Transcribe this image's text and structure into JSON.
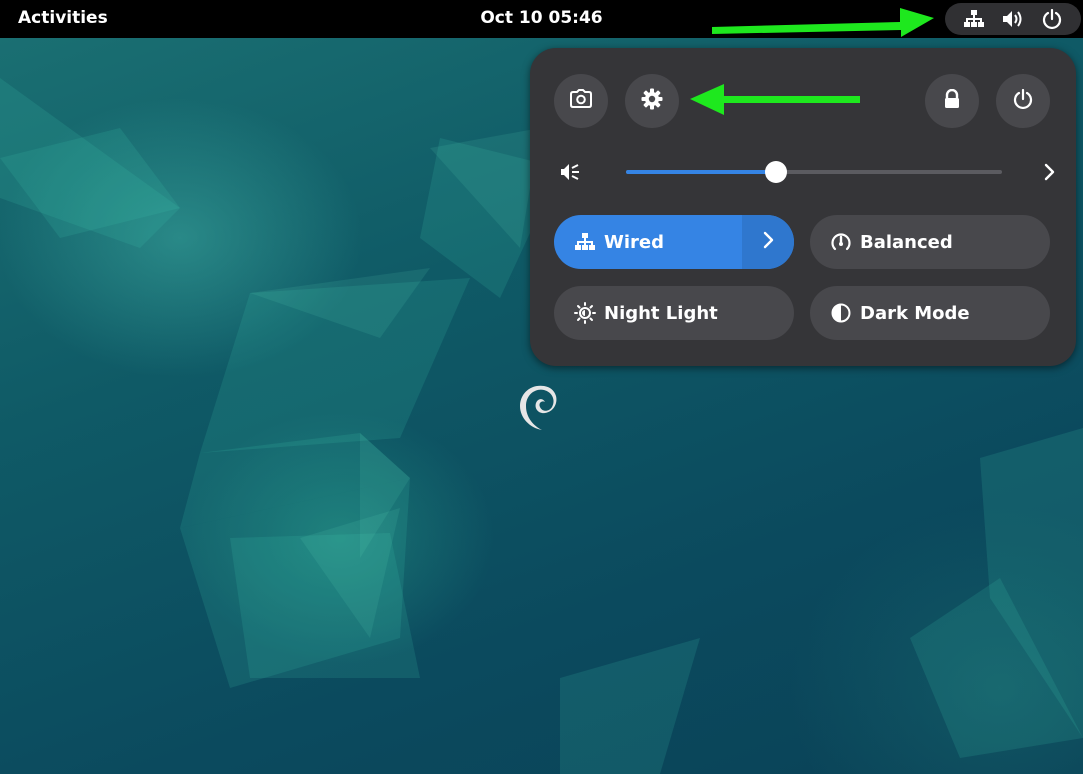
{
  "topbar": {
    "activities_label": "Activities",
    "clock": "Oct 10  05:46",
    "status_icons": [
      "network-wired-icon",
      "volume-icon",
      "power-icon"
    ]
  },
  "quick_settings": {
    "buttons_left": [
      "screenshot-icon",
      "settings-gear-icon"
    ],
    "buttons_right": [
      "lock-icon",
      "power-icon"
    ],
    "volume": {
      "icon": "volume-muted-icon",
      "level": 0.4
    },
    "toggles": [
      {
        "label": "Wired",
        "icon": "network-wired-icon",
        "active": true,
        "has_menu": true
      },
      {
        "label": "Balanced",
        "icon": "power-profile-icon",
        "active": false
      },
      {
        "label": "Night Light",
        "icon": "night-light-icon",
        "active": false
      },
      {
        "label": "Dark Mode",
        "icon": "dark-mode-icon",
        "active": false
      }
    ]
  },
  "colors": {
    "accent": "#3584e4",
    "menu_bg": "#353538",
    "button_bg": "#48484c",
    "annotation_arrow": "#1ee81e"
  }
}
